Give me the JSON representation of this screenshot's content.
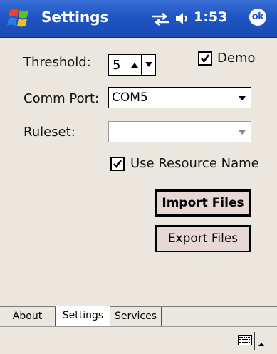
{
  "titlebar": {
    "title": "Settings",
    "time": "1:53",
    "ok_label": "ok",
    "start_icon": "windows-flag-icon",
    "connectivity_icon": "connectivity-icon",
    "volume_icon": "speaker-icon"
  },
  "form": {
    "threshold_label": "Threshold:",
    "threshold_value": "5",
    "demo_label": "Demo",
    "demo_checked": true,
    "comm_port_label": "Comm Port:",
    "comm_port_value": "COM5",
    "ruleset_label": "Ruleset:",
    "ruleset_value": "",
    "use_resource_name_label": "Use Resource Name",
    "use_resource_name_checked": true,
    "import_button": "Import Files",
    "export_button": "Export Files"
  },
  "tabs": [
    {
      "label": "About",
      "active": false
    },
    {
      "label": "Settings",
      "active": true
    },
    {
      "label": "Services",
      "active": false
    }
  ],
  "menubar": {
    "keyboard_icon": "keyboard-icon",
    "sip_arrow_icon": "up-arrow-icon"
  },
  "colors": {
    "titlebar": "#1f55c4",
    "background": "#ebe6de",
    "button_face": "#e7d8d6"
  }
}
